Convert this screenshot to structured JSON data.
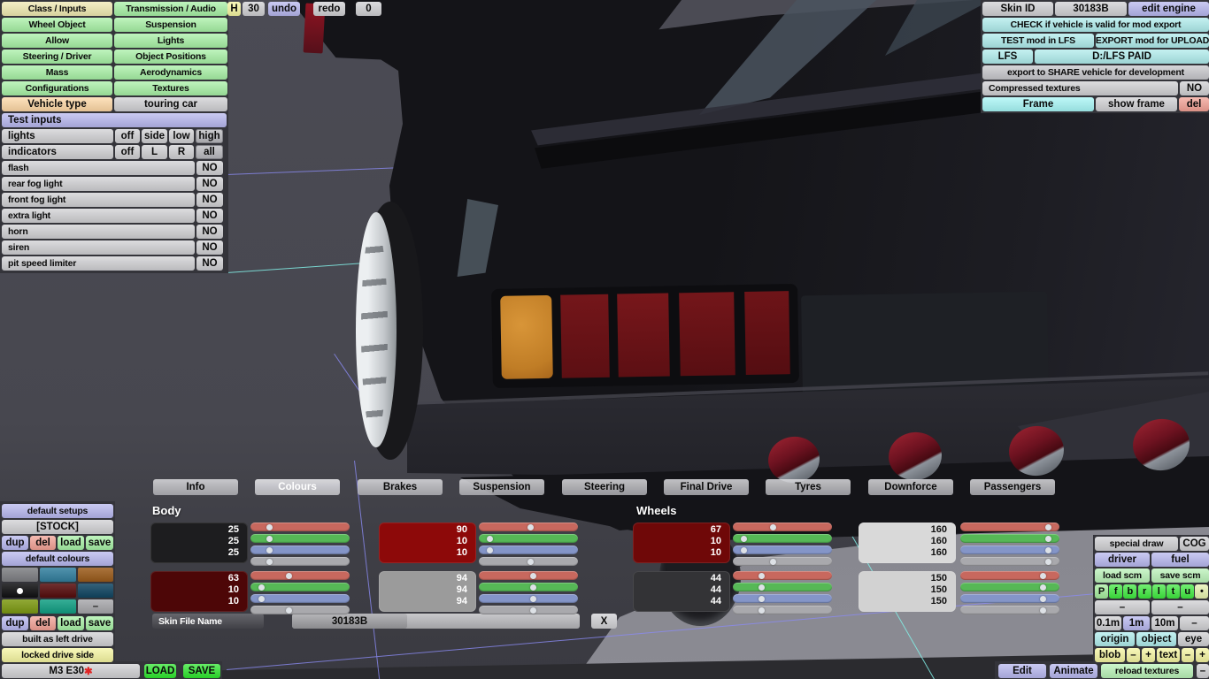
{
  "menu": {
    "left_col": [
      "Class / Inputs",
      "Wheel Object",
      "Allow",
      "Steering / Driver",
      "Mass",
      "Configurations"
    ],
    "right_col": [
      "Transmission / Audio",
      "Suspension",
      "Lights",
      "Object Positions",
      "Aerodynamics",
      "Textures"
    ],
    "vehicle_type_label": "Vehicle type",
    "vehicle_type_value": "touring car"
  },
  "topbar": {
    "h": "H",
    "value": "30",
    "undo": "undo",
    "redo": "redo",
    "zero": "0"
  },
  "test_inputs": {
    "title": "Test inputs",
    "lights": {
      "label": "lights",
      "options": [
        "off",
        "side",
        "low",
        "high"
      ],
      "selected": "high"
    },
    "indicators": {
      "label": "indicators",
      "options": [
        "off",
        "L",
        "R",
        "all"
      ],
      "selected": "all"
    },
    "toggles": [
      {
        "label": "flash",
        "value": "NO"
      },
      {
        "label": "rear fog light",
        "value": "NO"
      },
      {
        "label": "front fog light",
        "value": "NO"
      },
      {
        "label": "extra light",
        "value": "NO"
      },
      {
        "label": "horn",
        "value": "NO"
      },
      {
        "label": "siren",
        "value": "NO"
      },
      {
        "label": "pit speed limiter",
        "value": "NO"
      }
    ]
  },
  "mod_panel": {
    "skin_id_label": "Skin ID",
    "skin_id_value": "30183B",
    "edit_engine": "edit engine",
    "check": "CHECK if vehicle is valid for mod export",
    "test": "TEST mod in LFS",
    "export": "EXPORT mod for UPLOAD",
    "lfs": "LFS",
    "path": "D:/LFS PAID",
    "share": "export to SHARE vehicle for development",
    "compressed": "Compressed textures",
    "compressed_value": "NO",
    "frame": "Frame",
    "show_frame": "show frame",
    "del": "del"
  },
  "tabs": {
    "items": [
      "Info",
      "Colours",
      "Brakes",
      "Suspension",
      "Steering",
      "Final Drive",
      "Tyres",
      "Downforce",
      "Passengers"
    ],
    "selected": "Colours"
  },
  "colours": {
    "body_label": "Body",
    "wheels_label": "Wheels",
    "slider_colors": [
      "#c8685e",
      "#56b856",
      "#8495c8",
      "#a9a9ad"
    ],
    "slider_max": 170,
    "groups": [
      {
        "section": "body",
        "col": 0,
        "row": 0,
        "swatch": "#1d1d1f",
        "text": "#ffffff",
        "values": [
          25,
          25,
          25
        ]
      },
      {
        "section": "body",
        "col": 0,
        "row": 1,
        "swatch": "#4d0607",
        "text": "#ffffff",
        "values": [
          63,
          10,
          10
        ]
      },
      {
        "section": "body",
        "col": 1,
        "row": 0,
        "swatch": "#8d0909",
        "text": "#ffffff",
        "values": [
          90,
          10,
          10
        ]
      },
      {
        "section": "body",
        "col": 1,
        "row": 1,
        "swatch": "#9b9b9b",
        "text": "#ffffff",
        "values": [
          94,
          94,
          94
        ]
      },
      {
        "section": "wheels",
        "col": 0,
        "row": 0,
        "swatch": "#6f0808",
        "text": "#ffffff",
        "values": [
          67,
          10,
          10
        ]
      },
      {
        "section": "wheels",
        "col": 0,
        "row": 1,
        "swatch": "#333336",
        "text": "#ffffff",
        "values": [
          44,
          44,
          44
        ]
      },
      {
        "section": "wheels",
        "col": 1,
        "row": 0,
        "swatch": "#d9d9d9",
        "text": "#111111",
        "values": [
          160,
          160,
          160
        ]
      },
      {
        "section": "wheels",
        "col": 1,
        "row": 1,
        "swatch": "#d2d2d2",
        "text": "#111111",
        "values": [
          150,
          150,
          150
        ]
      }
    ]
  },
  "skin_file": {
    "label": "Skin File Name",
    "value": "30183B",
    "clear": "X"
  },
  "setups": {
    "default_setups": "default setups",
    "stock": "[STOCK]",
    "actions": [
      "dup",
      "del",
      "load",
      "save"
    ],
    "default_colours": "default colours",
    "palette": [
      [
        "#7f8084",
        "#33809f",
        "#9c5c1b"
      ],
      [
        "#101012",
        "#570c0c",
        "#114663"
      ],
      [
        "#7e9b13",
        "#12a084",
        "#aaaaae"
      ]
    ],
    "palette_selected_row": 1,
    "palette_selected_col": 0,
    "palette_dash": "–",
    "built": "built as left drive",
    "locked": "locked drive side"
  },
  "bottom_bar": {
    "model": "M3 E30",
    "star": "✱",
    "load": "LOAD",
    "save": "SAVE",
    "edit": "Edit",
    "animate": "Animate",
    "reload": "reload textures",
    "dash": "–"
  },
  "tools": {
    "special_draw": "special draw",
    "cog": "COG",
    "driver": "driver",
    "fuel": "fuel",
    "load_scm": "load scm",
    "save_scm": "save scm",
    "letters": [
      "P",
      "f",
      "b",
      "r",
      "l",
      "t",
      "u",
      "•"
    ],
    "dash_row": [
      "–",
      "–"
    ],
    "scale": [
      "0.1m",
      "1m",
      "10m",
      "–"
    ],
    "scale_selected": "1m",
    "view": [
      "origin",
      "object",
      "eye"
    ],
    "blob_row": [
      "blob",
      "–",
      "+",
      "text",
      "–",
      "+"
    ]
  },
  "colors": {
    "button_green": "#a6f0a4",
    "lavender": "#b6b6ee",
    "cyan": "#aeecec",
    "salmon": "#f2a094",
    "yellow": "#f5f5a0",
    "bright_green": "#2ce62c",
    "pale_green": "#b9f2b7",
    "letter_green": "#3de93d",
    "letter_pale": "#a4ec9c",
    "letter_dot_cell": "#e6f2ae",
    "grey_button": "#cfcfd2",
    "viewport_grey": "#4a4a52",
    "floor_grey": "#84848c",
    "taillight_red": "#6b1113",
    "indicator_orange": "#cd8730",
    "grid_line": "#8b8bf2",
    "grid_line_cyan": "#82f0e8"
  }
}
